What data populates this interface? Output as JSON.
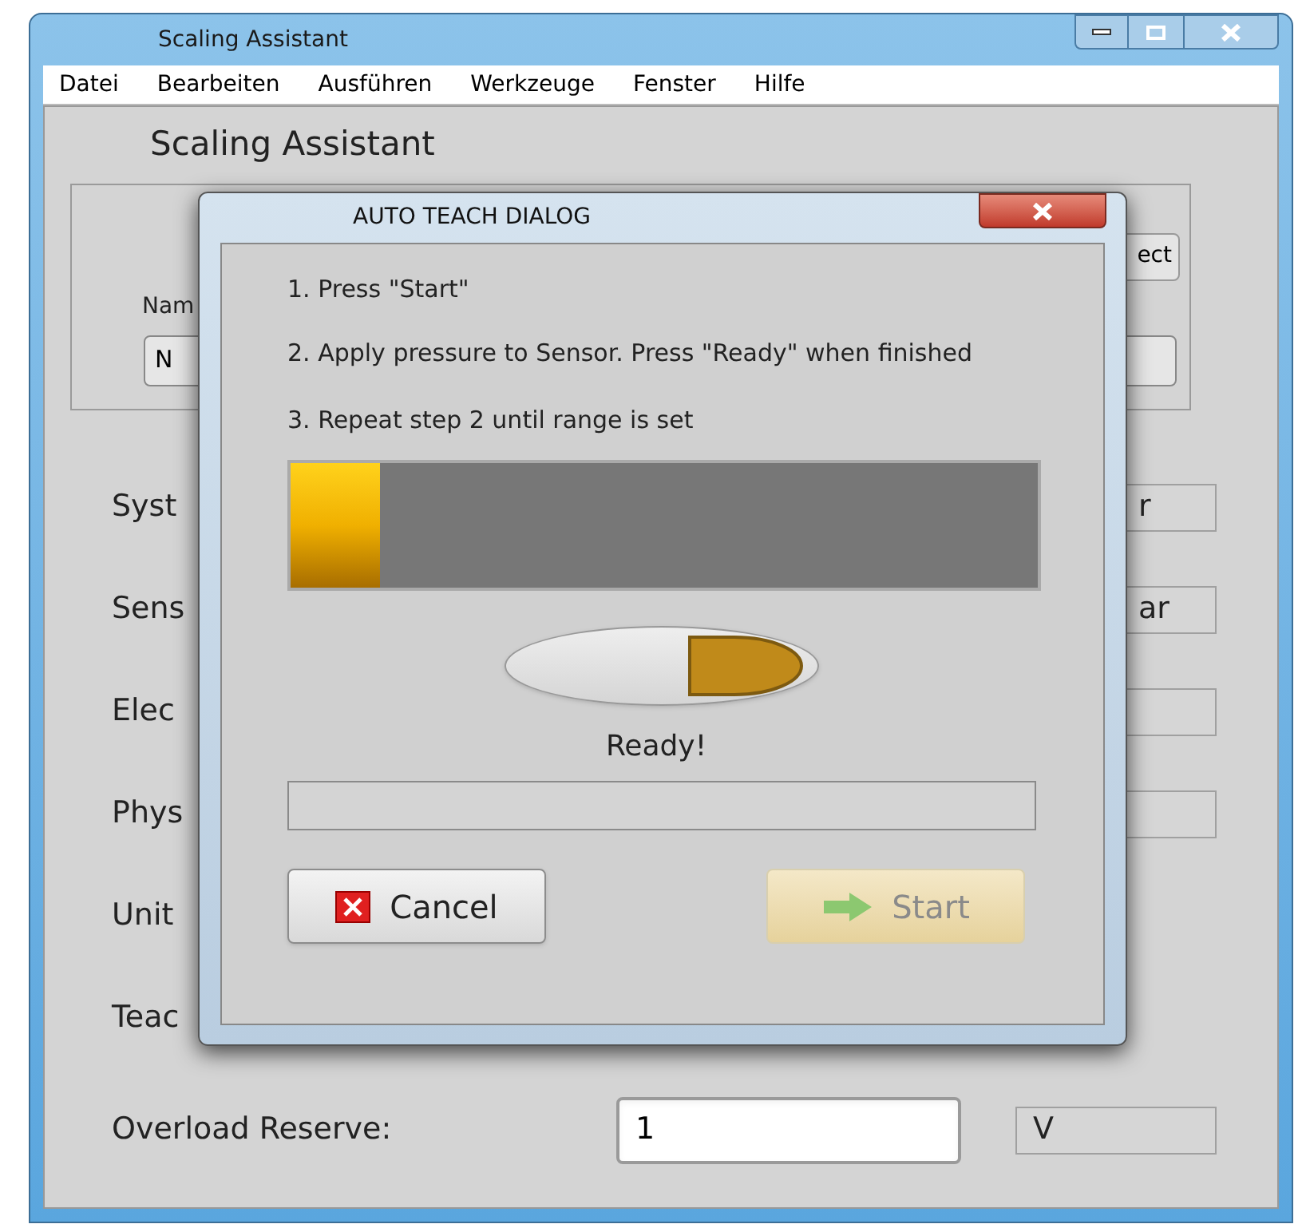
{
  "window": {
    "title": "Scaling Assistant"
  },
  "menu": [
    {
      "label": "Datei"
    },
    {
      "label": "Bearbeiten"
    },
    {
      "label": "Ausführen"
    },
    {
      "label": "Werkzeuge"
    },
    {
      "label": "Fenster"
    },
    {
      "label": "Hilfe"
    }
  ],
  "heading": "Scaling Assistant",
  "group": {
    "name_label": "Nam",
    "name_value": "N",
    "right_button": "ect"
  },
  "rows": [
    {
      "label": "Syst",
      "unit_box": true,
      "unit": "r"
    },
    {
      "label": "Sens",
      "unit_box": true,
      "unit": "ar"
    },
    {
      "label": "Elec",
      "unit_box": true
    },
    {
      "label": "Phys",
      "unit_box": true
    },
    {
      "label": "Unit",
      "unit_box": false
    },
    {
      "label": "Teac",
      "unit_box": false
    },
    {
      "label": "Overload Reserve:",
      "unit_box": true,
      "value": "1",
      "unit": "V"
    }
  ],
  "dialog": {
    "title": "AUTO TEACH DIALOG",
    "steps": [
      "1. Press \"Start\"",
      "2. Apply pressure to Sensor. Press \"Ready\" when finished",
      "3. Repeat step 2 until range is set"
    ],
    "progress": {
      "level": 0.12
    },
    "toggle": {
      "on": true
    },
    "status": "Ready!",
    "buttons": [
      {
        "kind": "cancel",
        "label": "Cancel",
        "disabled": false
      },
      {
        "kind": "start",
        "label": "Start",
        "disabled": true
      }
    ]
  }
}
